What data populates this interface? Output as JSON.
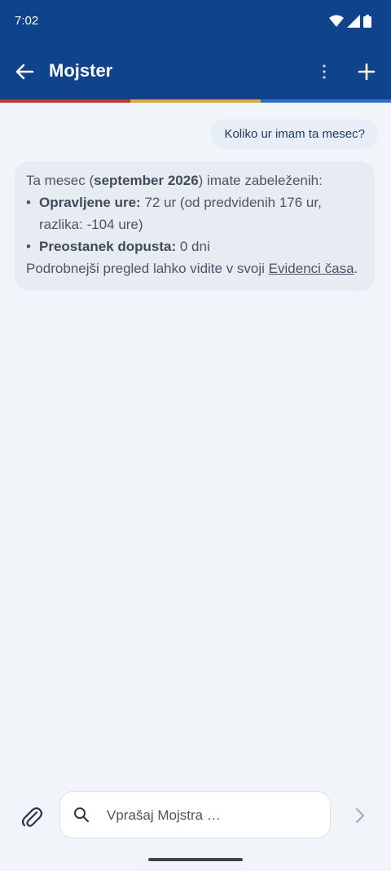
{
  "status_bar": {
    "time": "7:02"
  },
  "app_bar": {
    "title": "Mojster"
  },
  "icons": {
    "back": "arrow-left-icon",
    "more": "more-vert-icon",
    "add": "plus-icon",
    "attach": "paperclip-icon",
    "search": "search-icon",
    "send": "chevron-right-icon"
  },
  "colors": {
    "header": "#0f438c",
    "stripe_red": "#c0392b",
    "stripe_yellow": "#e0a82e",
    "stripe_blue": "#2f6fd0",
    "background": "#f1f4f9"
  },
  "chat": {
    "user_message": "Koliko ur imam ta mesec?",
    "bot": {
      "intro_pre": "Ta mesec (",
      "intro_bold": "september 2026",
      "intro_post": ") imate zabeleženih:",
      "item1_label": "Opravljene ure:",
      "item1_value": " 72 ur (od predvidenih 176 ur, razlika: -104 ure)",
      "item2_label": "Preostanek dopusta:",
      "item2_value": " 0 dni",
      "outro_pre": "Podrobnejši pregled lahko vidite v svoji ",
      "outro_link": "Evidenci časa",
      "outro_post": "."
    }
  },
  "composer": {
    "placeholder": "Vprašaj Mojstra …"
  }
}
